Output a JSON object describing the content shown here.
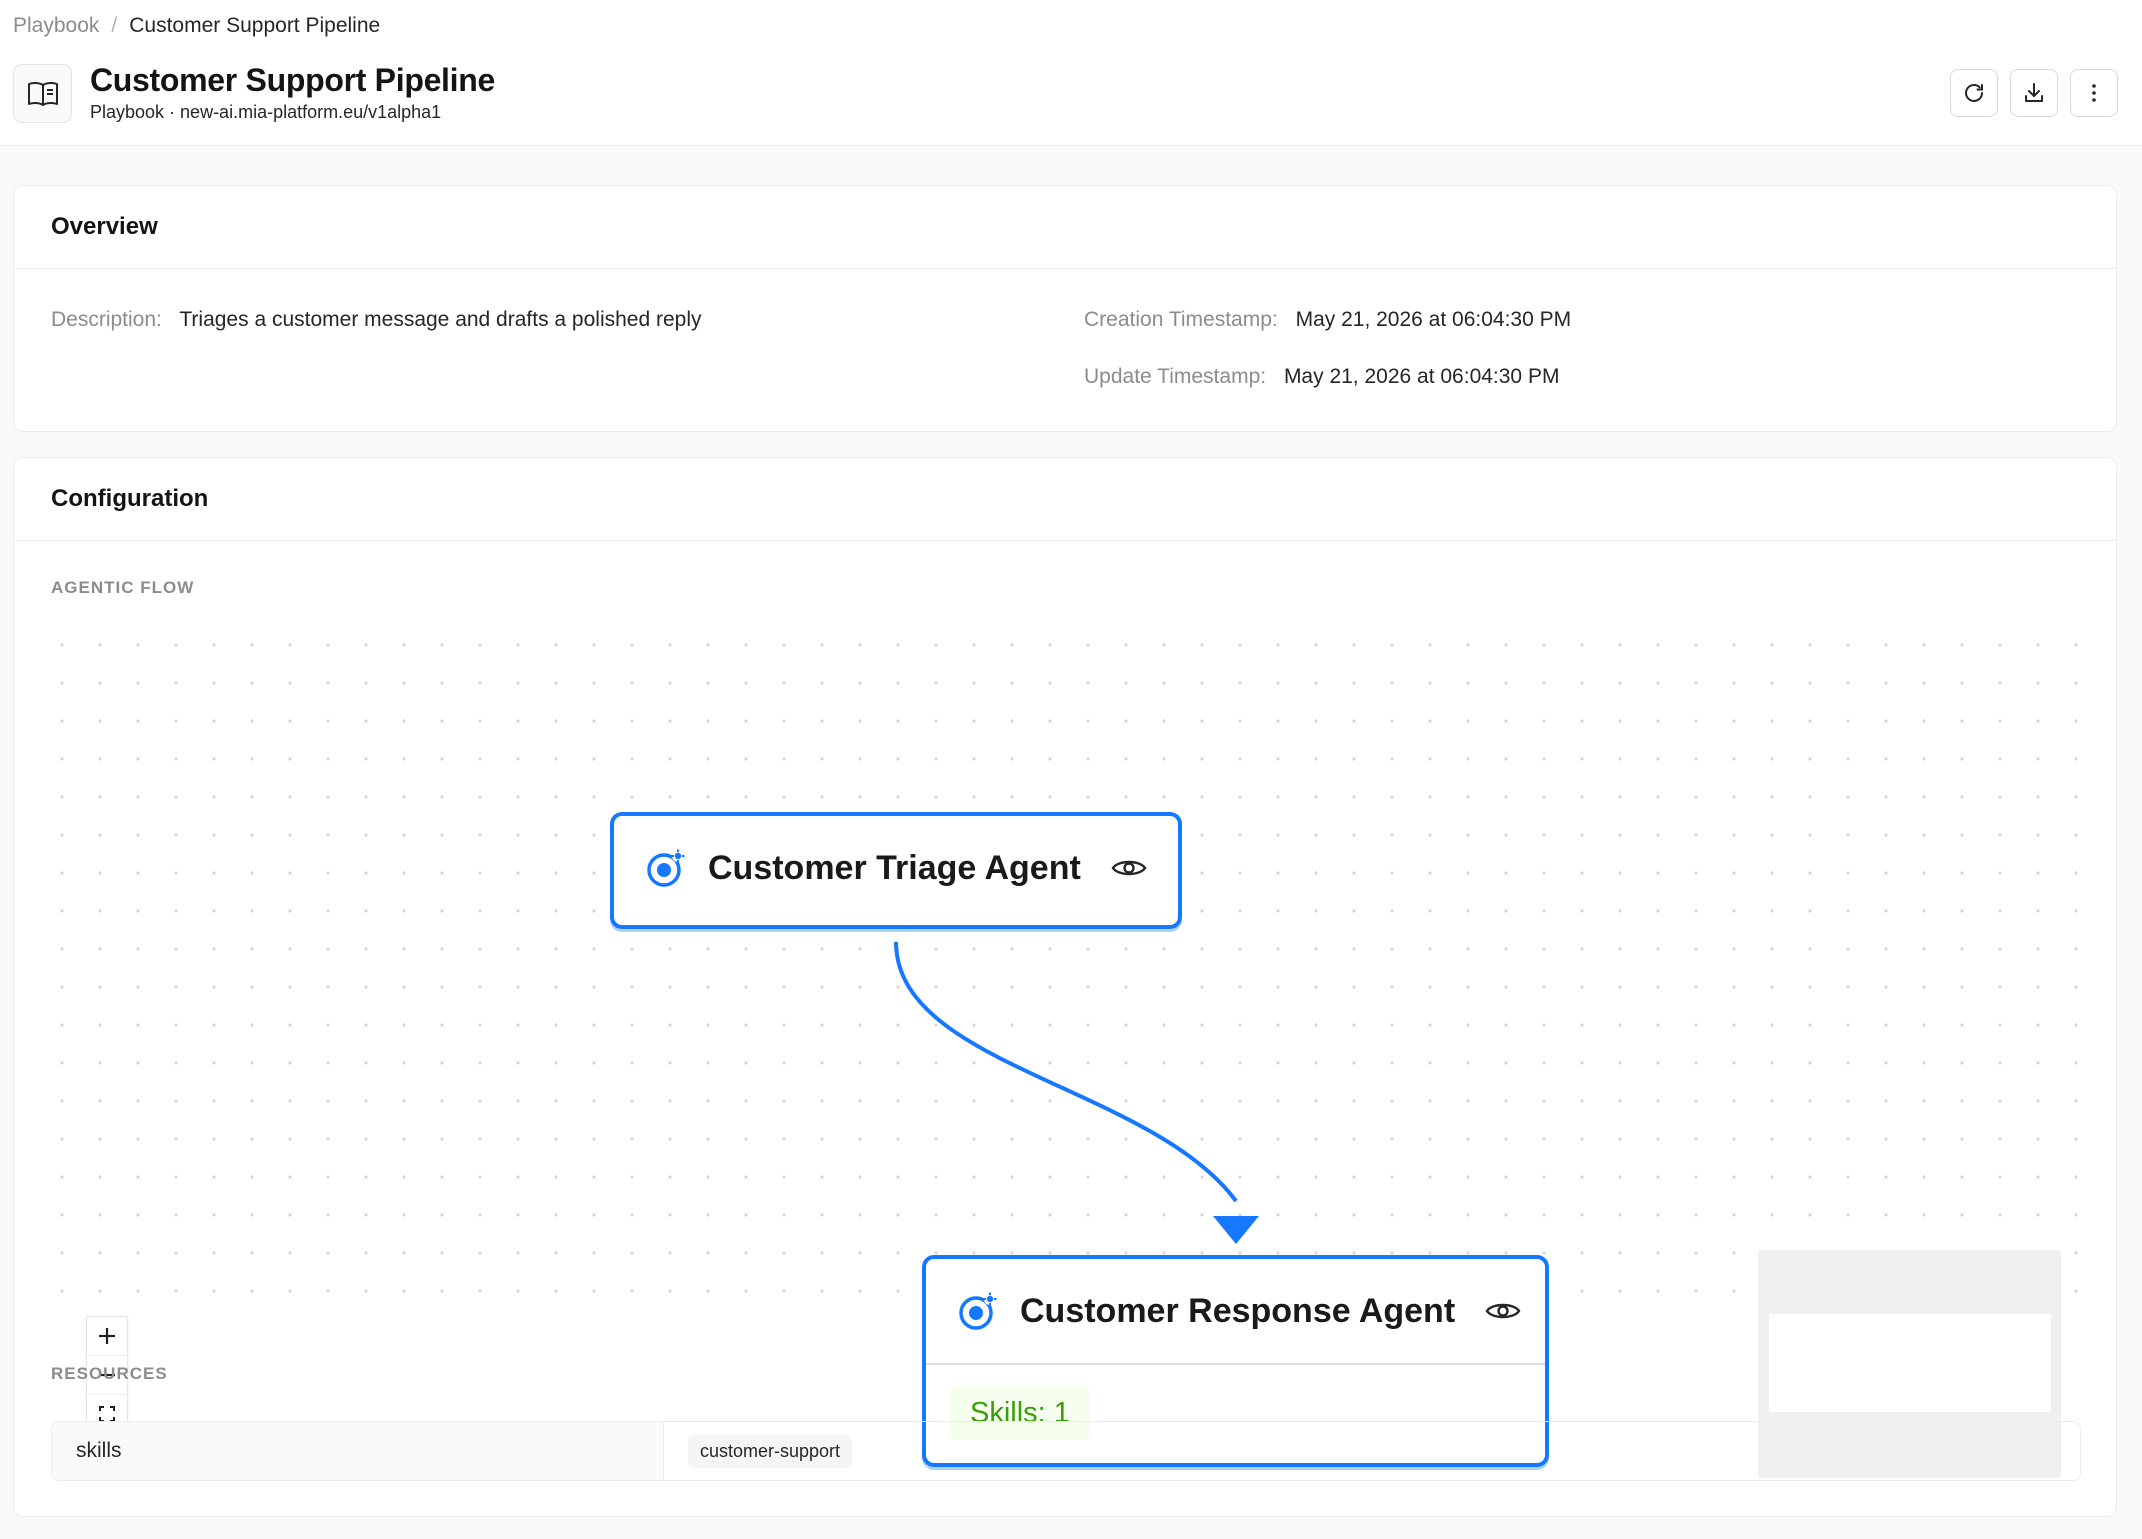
{
  "breadcrumb": {
    "parent": "Playbook",
    "separator": "/",
    "current": "Customer Support Pipeline"
  },
  "header": {
    "title": "Customer Support Pipeline",
    "subtitle": "Playbook · new-ai.mia-platform.eu/v1alpha1",
    "icon": "book-icon",
    "actions": [
      {
        "icon": "refresh-icon"
      },
      {
        "icon": "download-icon"
      },
      {
        "icon": "more-vertical-icon"
      }
    ]
  },
  "overview": {
    "title": "Overview",
    "description_label": "Description",
    "description_value": "Triages a customer message and drafts a polished reply",
    "creation_label": "Creation Timestamp",
    "creation_value": "May 21, 2026 at 06:04:30 PM",
    "update_label": "Update Timestamp",
    "update_value": "May 21, 2026 at 06:04:30 PM"
  },
  "configuration": {
    "title": "Configuration",
    "agentic_flow_label": "AGENTIC FLOW",
    "nodes": [
      {
        "title": "Customer Triage Agent",
        "icon": "agent-icon"
      },
      {
        "title": "Customer Response Agent",
        "icon": "agent-icon",
        "tag": "Skills: 1"
      }
    ],
    "zoom_controls": [
      "zoom-in-icon",
      "zoom-out-icon",
      "fit-view-icon",
      "fullscreen-icon"
    ],
    "resources_label": "RESOURCES",
    "resources": [
      {
        "key": "skills",
        "value": "customer-support"
      }
    ]
  },
  "colors": {
    "accent": "#1677ff",
    "skills_tag_text": "#389e0d",
    "skills_tag_bg": "#f6ffed"
  }
}
